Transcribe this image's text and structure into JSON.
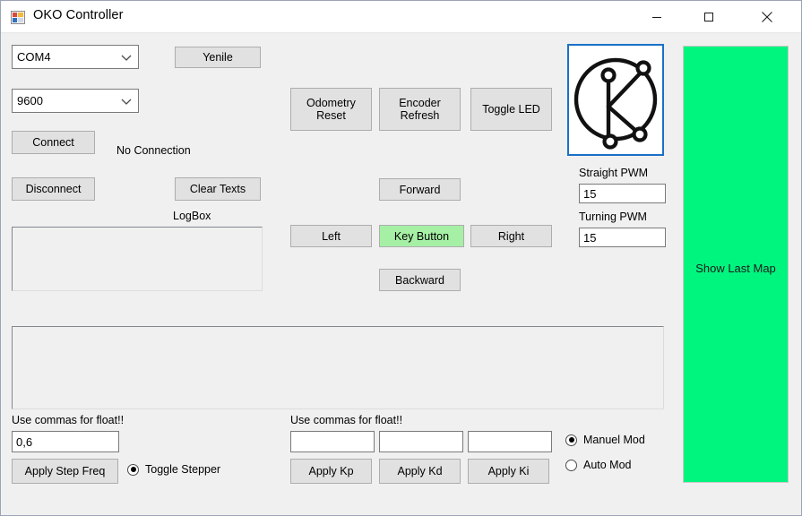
{
  "window": {
    "title": "OKO Controller",
    "icon": "winforms-app-icon",
    "controls": {
      "minimize": "minimize-icon",
      "maximize": "maximize-icon",
      "close": "close-icon"
    }
  },
  "connection": {
    "port_select": {
      "value": "COM4",
      "chevron": "chevron-down-icon"
    },
    "baud_select": {
      "value": "9600",
      "chevron": "chevron-down-icon"
    },
    "refresh_button": "Yenile",
    "connect_button": "Connect",
    "disconnect_button": "Disconnect",
    "status_text": "No Connection",
    "clear_button": "Clear Texts",
    "logbox_label": "LogBox",
    "logbox_value": ""
  },
  "commands": {
    "odometry_reset": "Odometry\nReset",
    "encoder_refresh": "Encoder\nRefresh",
    "toggle_led": "Toggle LED"
  },
  "drive": {
    "forward": "Forward",
    "left": "Left",
    "key_button": "Key Button",
    "right": "Right",
    "backward": "Backward",
    "key_button_color": "#a6f0a6"
  },
  "pwm": {
    "straight_label": "Straight PWM",
    "straight_value": "15",
    "turning_label": "Turning PWM",
    "turning_value": "15"
  },
  "map": {
    "label": "Show Last Map",
    "color": "#00f57f"
  },
  "output": {
    "value": ""
  },
  "stepper": {
    "hint": "Use commas for float!!",
    "freq_value": "0,6",
    "apply_button": "Apply Step Freq",
    "toggle_label": "Toggle Stepper",
    "toggle_checked": true
  },
  "pid": {
    "hint": "Use commas for float!!",
    "kp_value": "",
    "kd_value": "",
    "ki_value": "",
    "apply_kp": "Apply Kp",
    "apply_kd": "Apply Kd",
    "apply_ki": "Apply Ki"
  },
  "mode": {
    "manual_label": "Manuel Mod",
    "manual_checked": true,
    "auto_label": "Auto Mod",
    "auto_checked": false
  }
}
